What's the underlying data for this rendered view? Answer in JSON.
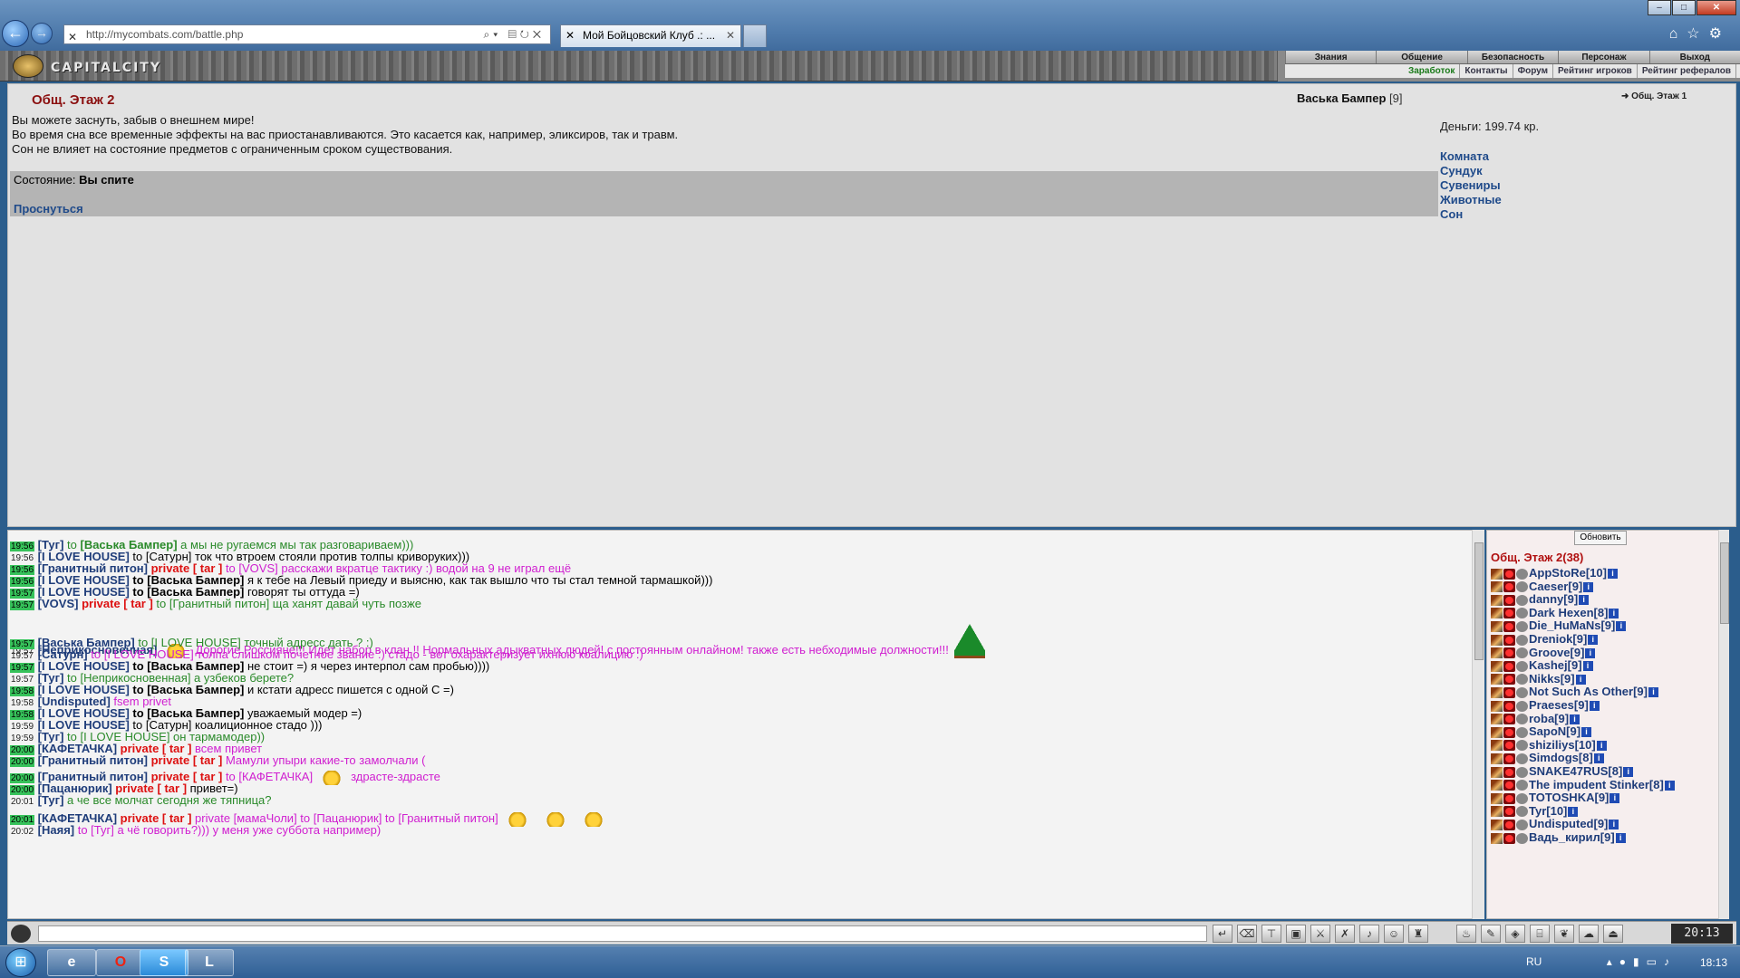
{
  "browser": {
    "url": "http://mycombats.com/battle.php",
    "tab_title": "Мой Бойцовский Клуб .: ...",
    "back_icon": "back-arrow-icon",
    "forward_icon": "forward-arrow-icon"
  },
  "header": {
    "logo_text": "CAPITALCITY",
    "menu": [
      "Знания",
      "Общение",
      "Безопасность",
      "Персонаж",
      "Выход"
    ],
    "submenu": [
      "Заработок",
      "Контакты",
      "Форум",
      "Рейтинг игроков",
      "Рейтинг рефералов"
    ]
  },
  "location": {
    "title": "Общ. Этаж 2",
    "exit_link": "Общ. Этаж 1"
  },
  "character": {
    "name": "Васька Бампер",
    "level": "[9]",
    "money": "Деньги: 199.74 кр."
  },
  "sleep": {
    "lines": [
      "Вы можете заснуть, забыв о внешнем мире!",
      "Во время сна все временные эффекты на вас приостанавливаются. Это касается как, например, эликсиров, так и травм.",
      "Сон не влияет на состояние предметов с ограниченным сроком существования."
    ],
    "state_label": "Состояние:",
    "state_value": "Вы спите",
    "wake_link": "Проснуться"
  },
  "right_links": [
    "Комната",
    "Сундук",
    "Сувениры",
    "Животные",
    "Сон"
  ],
  "chat": {
    "messages": [
      {
        "time": "19:56",
        "hl": true,
        "parts": [
          [
            "nk",
            "[Туг]"
          ],
          [
            "g",
            " to "
          ],
          [
            "g b",
            "[Васька Бампер]"
          ],
          [
            "g",
            " а мы не ругаемся мы так разговариваем)))"
          ]
        ]
      },
      {
        "time": "19:56",
        "hl": false,
        "parts": [
          [
            "nk",
            "[I LOVE HOUSE]"
          ],
          [
            "",
            "  to [Сатурн] ток что втроем стояли против толпы криворуких)))"
          ]
        ]
      },
      {
        "time": "19:56",
        "hl": true,
        "parts": [
          [
            "nk",
            "[Гранитный питон]"
          ],
          [
            "pv",
            " private [ tar ] "
          ],
          [
            "m",
            "to [VOVS] расскажи вкратце тактику :) водой на 9 не играл ещё"
          ]
        ]
      },
      {
        "time": "19:56",
        "hl": true,
        "parts": [
          [
            "nk",
            "[I LOVE HOUSE]"
          ],
          [
            "tg",
            " to [Васька Бампер]"
          ],
          [
            "",
            " я к тебе на Левый приеду и выясню, как так вышло что ты стал темной тармашкой)))"
          ]
        ]
      },
      {
        "time": "19:57",
        "hl": true,
        "parts": [
          [
            "nk",
            "[I LOVE HOUSE]"
          ],
          [
            "tg",
            " to [Васька Бампер]"
          ],
          [
            "",
            " говорят ты оттуда =)"
          ]
        ]
      },
      {
        "time": "19:57",
        "hl": true,
        "parts": [
          [
            "nk",
            "[VOVS]"
          ],
          [
            "pv",
            " private [ tar ] "
          ],
          [
            "g",
            "to [Гранитный питон] ща ханят давай чуть позже"
          ]
        ]
      },
      {
        "time": "19:57",
        "hl": false,
        "parts": [
          [
            "nk",
            "[Неприкосновенная]"
          ],
          [
            "smile",
            ""
          ],
          [
            "m",
            "Дорогие Россияне!!! Идет набор в клан !! Нормальных адыкватных людей! с постоянным онлайном! также есть небходимые должности!!!"
          ],
          [
            "tree",
            ""
          ]
        ]
      },
      {
        "time": "19:57",
        "hl": true,
        "parts": [
          [
            "nk",
            "[Васька Бампер]"
          ],
          [
            "g",
            " to [I LOVE HOUSE] точный адресс дать ? :)"
          ]
        ]
      },
      {
        "time": "19:57",
        "hl": false,
        "parts": [
          [
            "nk",
            "[Сатурн]"
          ],
          [
            "m",
            " to [I LOVE HOUSE] толпа слишком почетное звание :) стадо - вот охарактеризует ихнюю коалицию :)"
          ]
        ]
      },
      {
        "time": "19:57",
        "hl": true,
        "parts": [
          [
            "nk",
            "[I LOVE HOUSE]"
          ],
          [
            "tg",
            " to [Васька Бампер]"
          ],
          [
            "",
            " не стоит =) я через интерпол сам пробью))))"
          ]
        ]
      },
      {
        "time": "19:57",
        "hl": false,
        "parts": [
          [
            "nk",
            "[Туг]"
          ],
          [
            "g",
            " to [Неприкосновенная] а узбеков берете?"
          ]
        ]
      },
      {
        "time": "19:58",
        "hl": true,
        "parts": [
          [
            "nk",
            "[I LOVE HOUSE]"
          ],
          [
            "tg",
            " to [Васька Бампер]"
          ],
          [
            "",
            " и кстати адресс пишется с одной С =)"
          ]
        ]
      },
      {
        "time": "19:58",
        "hl": false,
        "parts": [
          [
            "nk",
            "[Undisputed]"
          ],
          [
            "m",
            " fsem privet"
          ]
        ]
      },
      {
        "time": "19:58",
        "hl": true,
        "parts": [
          [
            "nk",
            "[I LOVE HOUSE]"
          ],
          [
            "tg",
            " to [Васька Бампер]"
          ],
          [
            "",
            " уважаемый модер =)"
          ]
        ]
      },
      {
        "time": "19:59",
        "hl": false,
        "parts": [
          [
            "nk",
            "[I LOVE HOUSE]"
          ],
          [
            "",
            " to [Сатурн] коалиционное стадо )))"
          ]
        ]
      },
      {
        "time": "19:59",
        "hl": false,
        "parts": [
          [
            "nk",
            "[Туг]"
          ],
          [
            "g",
            " to [I LOVE HOUSE] он тармамодер))"
          ]
        ]
      },
      {
        "time": "20:00",
        "hl": true,
        "parts": [
          [
            "nk",
            "[КАФЕТАЧКА]"
          ],
          [
            "pv",
            " private [ tar ] "
          ],
          [
            "m",
            "всем привет"
          ]
        ]
      },
      {
        "time": "20:00",
        "hl": true,
        "parts": [
          [
            "nk",
            "[Гранитный питон]"
          ],
          [
            "pv",
            " private [ tar ] "
          ],
          [
            "m",
            "Мамули упыри какие-то замолчали ("
          ]
        ]
      },
      {
        "time": "20:00",
        "hl": true,
        "parts": [
          [
            "nk",
            "[Гранитный питон]"
          ],
          [
            "pv",
            " private [ tar ] "
          ],
          [
            "m",
            "to [КАФЕТАЧКА]"
          ],
          [
            "smile",
            ""
          ],
          [
            "m",
            "здрасте-здрасте"
          ]
        ]
      },
      {
        "time": "20:00",
        "hl": true,
        "parts": [
          [
            "nk",
            "[Пацанюрик]"
          ],
          [
            "pv",
            " private [ tar ] "
          ],
          [
            "",
            " привет=)"
          ]
        ]
      },
      {
        "time": "20:01",
        "hl": false,
        "parts": [
          [
            "nk",
            "[Туг]"
          ],
          [
            "g",
            " а че все молчат сегодня же тяпница?"
          ]
        ]
      },
      {
        "time": "20:01",
        "hl": true,
        "parts": [
          [
            "nk",
            "[КАФЕТАЧКА]"
          ],
          [
            "pv",
            " private [ tar ] "
          ],
          [
            "m",
            "private [мамаЧоли] to [Пацанюрик] to [Гранитный питон]"
          ],
          [
            "smile",
            ""
          ],
          [
            "smile",
            ""
          ],
          [
            "smile",
            ""
          ]
        ]
      },
      {
        "time": "20:02",
        "hl": false,
        "parts": [
          [
            "nk",
            "[Наяя]"
          ],
          [
            "m",
            " to [Туг] а чё говорить?))) у меня уже суббота например)"
          ]
        ]
      }
    ]
  },
  "online": {
    "refresh_label": "Обновить",
    "title": "Общ. Этаж 2(38)",
    "users": [
      {
        "name": "AppStoRe",
        "level": "[10]"
      },
      {
        "name": "Caeser",
        "level": "[9]"
      },
      {
        "name": "danny",
        "level": "[9]"
      },
      {
        "name": "Dark Hexen",
        "level": "[8]"
      },
      {
        "name": "Die_HuMaNs",
        "level": "[9]"
      },
      {
        "name": "Dreniok",
        "level": "[9]"
      },
      {
        "name": "Groove",
        "level": "[9]"
      },
      {
        "name": "Kashej",
        "level": "[9]"
      },
      {
        "name": "Nikks",
        "level": "[9]"
      },
      {
        "name": "Not Such As Other",
        "level": "[9]"
      },
      {
        "name": "Praeses",
        "level": "[9]"
      },
      {
        "name": "roba",
        "level": "[9]"
      },
      {
        "name": "SapoN",
        "level": "[9]"
      },
      {
        "name": "shiziliys",
        "level": "[10]"
      },
      {
        "name": "Simdogs",
        "level": "[8]"
      },
      {
        "name": "SNAKE47RUS",
        "level": "[8]"
      },
      {
        "name": "The impudent Stinker",
        "level": "[8]"
      },
      {
        "name": "TOTOSHKA",
        "level": "[9]"
      },
      {
        "name": "Tyr",
        "level": "[10]"
      },
      {
        "name": "Undisputed",
        "level": "[9]"
      },
      {
        "name": "Вадь_кирил",
        "level": "[9]"
      }
    ]
  },
  "clock": "20:13",
  "taskbar": {
    "lang": "RU",
    "time": "18:13"
  }
}
